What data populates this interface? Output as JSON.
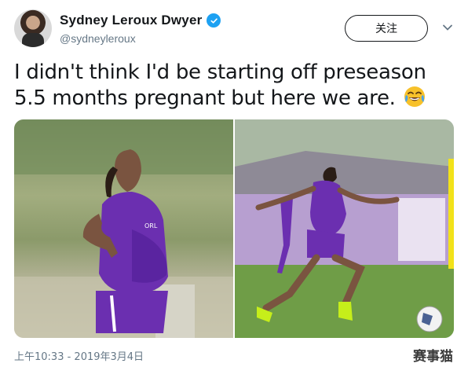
{
  "user": {
    "display_name": "Sydney Leroux Dwyer",
    "handle": "@sydneyleroux",
    "verified": true
  },
  "actions": {
    "follow_label": "关注",
    "more_icon": "chevron-down-icon"
  },
  "tweet": {
    "text": "I didn't think I'd be starting off preseason 5.5 months pregnant but here we are.",
    "emoji": "face-with-tears-of-joy"
  },
  "media": {
    "photos": [
      {
        "description_icon": "photo"
      },
      {
        "description_icon": "photo"
      }
    ]
  },
  "footer": {
    "timestamp": "上午10:33 - 2019年3月4日"
  },
  "watermark": "赛事猫",
  "colors": {
    "verified_badge": "#1da1f2",
    "jersey_purple": "#6b2fb0",
    "secondary_text": "#657786"
  }
}
